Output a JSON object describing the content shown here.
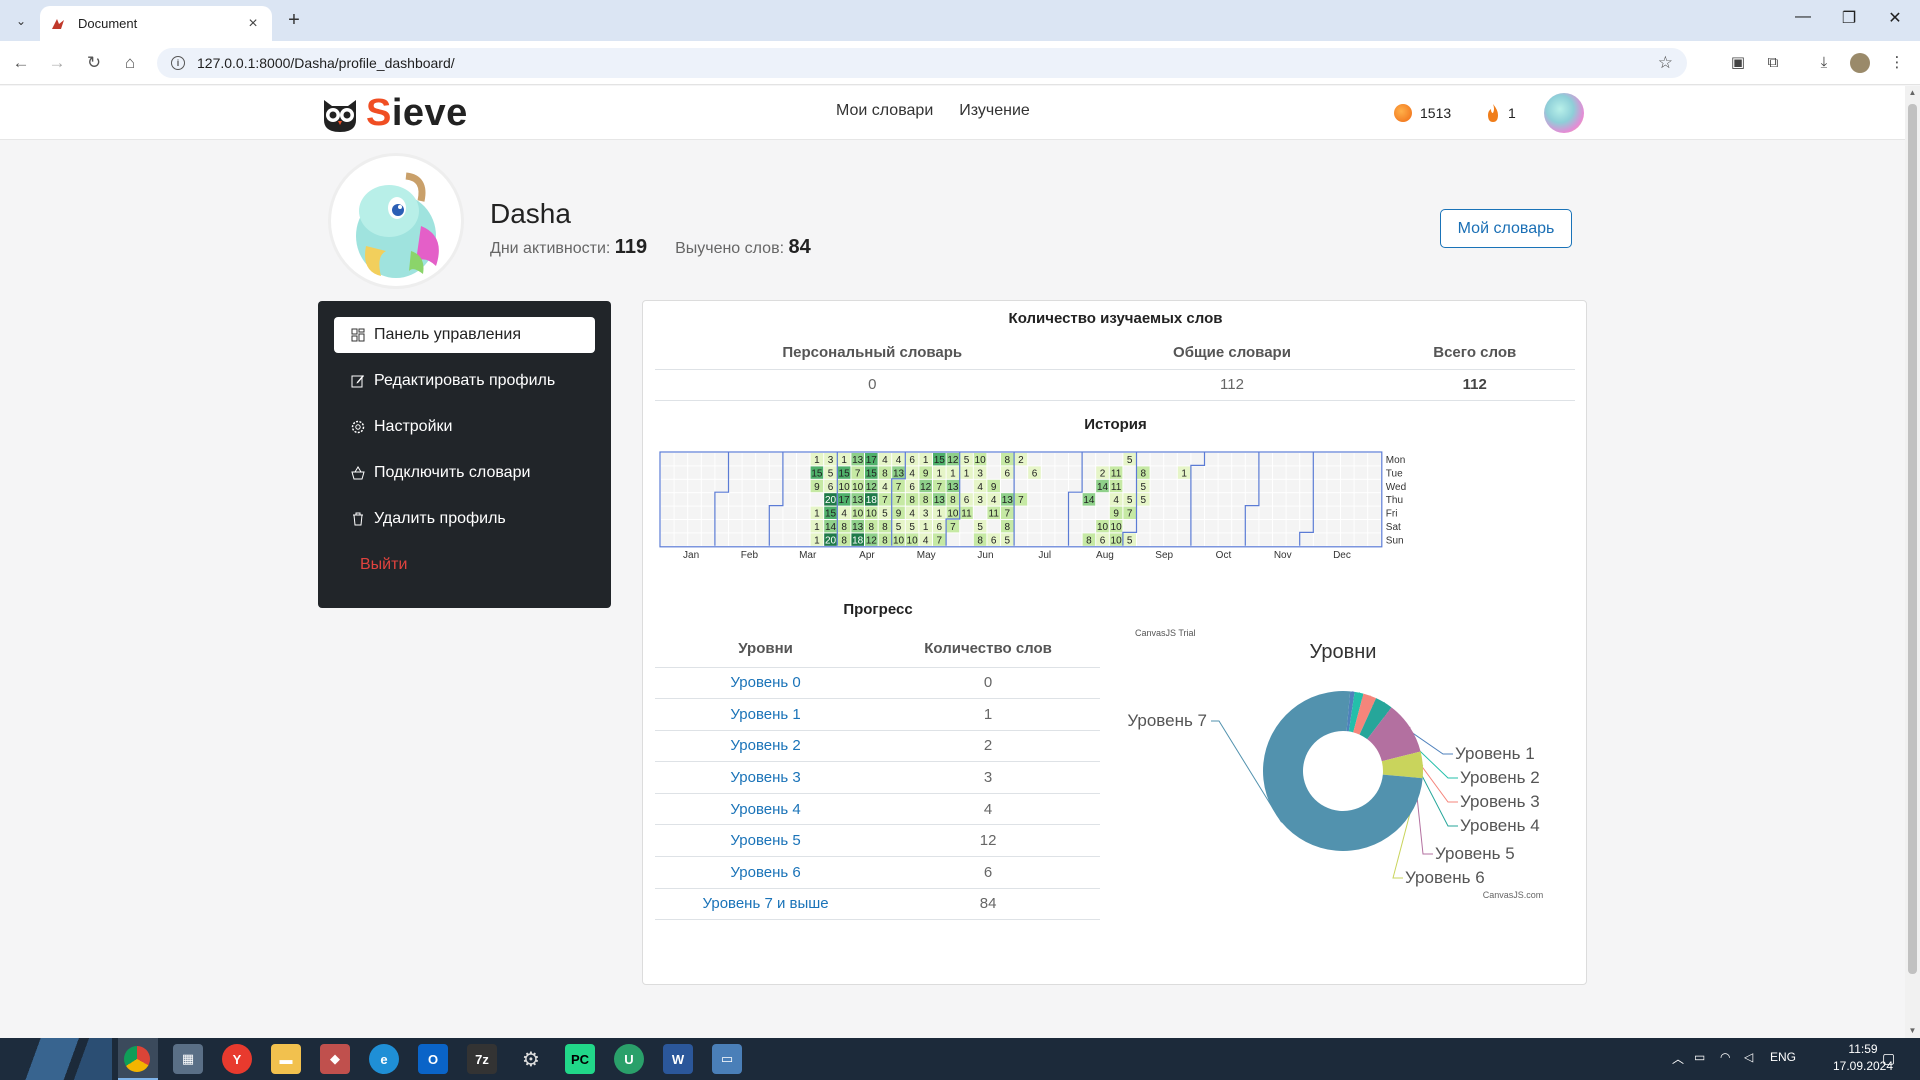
{
  "browser": {
    "tab_title": "Document",
    "url": "127.0.0.1:8000/Dasha/profile_dashboard/"
  },
  "header": {
    "brand_first": "S",
    "brand_rest": "ieve",
    "nav": [
      "Мои словари",
      "Изучение"
    ],
    "coins": "1513",
    "streak": "1"
  },
  "profile": {
    "name": "Dasha",
    "days_label": "Дни активности:",
    "days_value": "119",
    "learned_label": "Выучено слов:",
    "learned_value": "84",
    "my_dict_button": "Мой словарь"
  },
  "sidebar": {
    "items": [
      {
        "label": "Панель управления",
        "icon": "dashboard-icon"
      },
      {
        "label": "Редактировать профиль",
        "icon": "edit-icon"
      },
      {
        "label": "Настройки",
        "icon": "gear-icon"
      },
      {
        "label": "Подключить словари",
        "icon": "basket-icon"
      },
      {
        "label": "Удалить профиль",
        "icon": "trash-icon"
      }
    ],
    "logout": "Выйти"
  },
  "words": {
    "title": "Количество изучаемых слов",
    "headers": [
      "Персональный словарь",
      "Общие словари",
      "Всего слов"
    ],
    "values": [
      "0",
      "112",
      "112"
    ]
  },
  "history": {
    "title": "История",
    "months": [
      "Jan",
      "Feb",
      "Mar",
      "Apr",
      "May",
      "Jun",
      "Jul",
      "Aug",
      "Sep",
      "Oct",
      "Nov",
      "Dec"
    ],
    "days": [
      "Mon",
      "Tue",
      "Wed",
      "Thu",
      "Fri",
      "Sat",
      "Sun"
    ],
    "colors": {
      "l1": "#e6f5c8",
      "l2": "#c6e9a4",
      "l3": "#8fd08a",
      "l4": "#4fb06a",
      "l5": "#1f7a48",
      "empty": "#f4f4f4",
      "border": "#5b7bd5"
    },
    "weeks": [
      {
        "w": 11,
        "v": [
          1,
          15,
          9,
          null,
          1,
          1,
          1
        ]
      },
      {
        "w": 12,
        "v": [
          3,
          5,
          6,
          20,
          15,
          14,
          20
        ]
      },
      {
        "w": 13,
        "v": [
          1,
          15,
          10,
          17,
          4,
          8,
          8
        ]
      },
      {
        "w": 14,
        "v": [
          13,
          7,
          10,
          13,
          10,
          13,
          18
        ]
      },
      {
        "w": 15,
        "v": [
          17,
          15,
          12,
          18,
          10,
          8,
          12
        ]
      },
      {
        "w": 16,
        "v": [
          4,
          8,
          4,
          7,
          5,
          8,
          8
        ]
      },
      {
        "w": 17,
        "v": [
          4,
          13,
          7,
          7,
          9,
          5,
          10
        ]
      },
      {
        "w": 18,
        "v": [
          6,
          4,
          6,
          8,
          4,
          5,
          10
        ]
      },
      {
        "w": 19,
        "v": [
          1,
          9,
          12,
          8,
          3,
          1,
          4
        ]
      },
      {
        "w": 20,
        "v": [
          15,
          1,
          7,
          13,
          1,
          6,
          7
        ]
      },
      {
        "w": 21,
        "v": [
          12,
          1,
          13,
          8,
          10,
          7,
          null
        ]
      },
      {
        "w": 22,
        "v": [
          5,
          1,
          null,
          6,
          11,
          null,
          null
        ]
      },
      {
        "w": 23,
        "v": [
          10,
          3,
          4,
          3,
          null,
          5,
          8
        ]
      },
      {
        "w": 24,
        "v": [
          null,
          null,
          9,
          4,
          11,
          null,
          6
        ]
      },
      {
        "w": 25,
        "v": [
          8,
          6,
          null,
          13,
          7,
          8,
          5
        ]
      },
      {
        "w": 26,
        "v": [
          2,
          null,
          null,
          7,
          null,
          null,
          null
        ]
      },
      {
        "w": 27,
        "v": [
          null,
          6,
          null,
          null,
          null,
          null,
          null
        ]
      },
      {
        "w": 31,
        "v": [
          null,
          null,
          null,
          14,
          null,
          null,
          8
        ]
      },
      {
        "w": 32,
        "v": [
          null,
          2,
          14,
          null,
          null,
          10,
          6
        ]
      },
      {
        "w": 33,
        "v": [
          null,
          11,
          11,
          4,
          9,
          10,
          10
        ]
      },
      {
        "w": 34,
        "v": [
          5,
          null,
          null,
          5,
          7,
          null,
          5
        ]
      },
      {
        "w": 35,
        "v": [
          null,
          8,
          5,
          5,
          null,
          null,
          null
        ]
      },
      {
        "w": 38,
        "v": [
          null,
          1,
          null,
          null,
          null,
          null,
          null
        ]
      }
    ]
  },
  "progress": {
    "title": "Прогресс",
    "headers": [
      "Уровни",
      "Количество слов"
    ],
    "rows": [
      {
        "level": "Уровень 0",
        "count": "0"
      },
      {
        "level": "Уровень 1",
        "count": "1"
      },
      {
        "level": "Уровень 2",
        "count": "2"
      },
      {
        "level": "Уровень 3",
        "count": "3"
      },
      {
        "level": "Уровень 4",
        "count": "4"
      },
      {
        "level": "Уровень 5",
        "count": "12"
      },
      {
        "level": "Уровень 6",
        "count": "6"
      },
      {
        "level": "Уровень 7 и выше",
        "count": "84"
      }
    ]
  },
  "chart_data": {
    "type": "pie",
    "title": "Уровни",
    "trial_text": "CanvasJS Trial",
    "credit": "CanvasJS.com",
    "series": [
      {
        "name": "Уровень 1",
        "value": 1,
        "color": "#4f81bc"
      },
      {
        "name": "Уровень 2",
        "value": 2,
        "color": "#23bfaa"
      },
      {
        "name": "Уровень 3",
        "value": 3,
        "color": "#f5857b"
      },
      {
        "name": "Уровень 4",
        "value": 4,
        "color": "#26a69a"
      },
      {
        "name": "Уровень 5",
        "value": 12,
        "color": "#b370a0"
      },
      {
        "name": "Уровень 6",
        "value": 6,
        "color": "#c9d45c"
      },
      {
        "name": "Уровень 7",
        "value": 84,
        "color": "#5292ae"
      }
    ]
  },
  "taskbar": {
    "lang": "ENG",
    "time": "11:59",
    "date": "17.09.2024"
  }
}
